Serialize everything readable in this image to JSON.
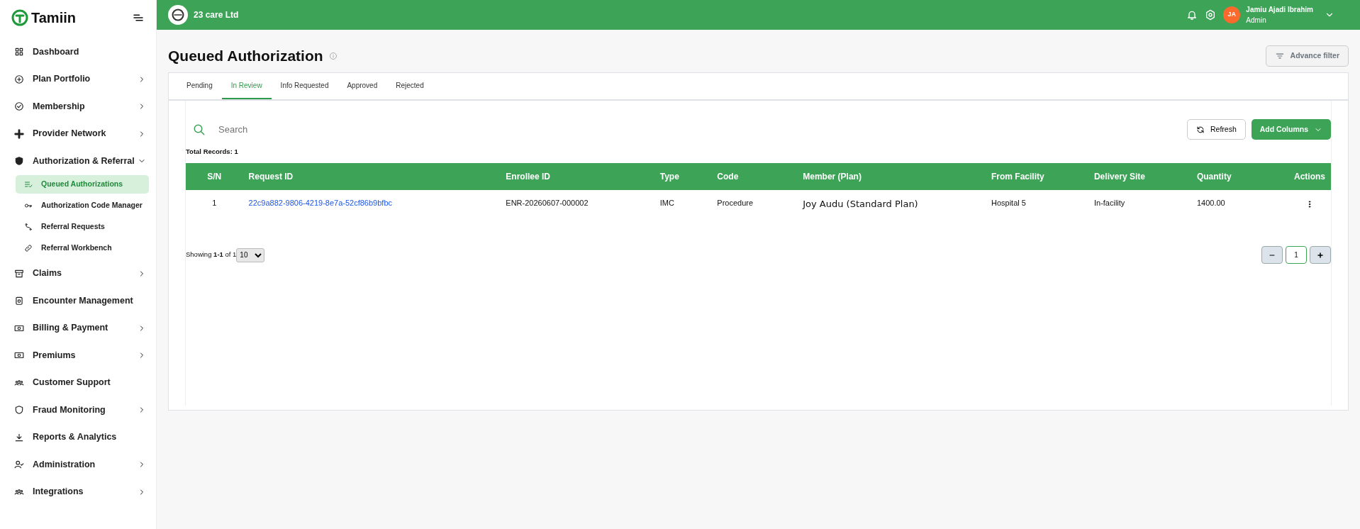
{
  "brand": {
    "name": "Tamiin"
  },
  "sidebar": {
    "items": [
      {
        "label": "Dashboard"
      },
      {
        "label": "Plan Portfolio",
        "expanded": false
      },
      {
        "label": "Membership",
        "expanded": false
      },
      {
        "label": "Provider Network",
        "expanded": false
      },
      {
        "label": "Authorization & Referral",
        "expanded": true,
        "children": [
          {
            "label": "Queued Authorizations",
            "selected": true
          },
          {
            "label": "Authorization Code Manager",
            "selected": false
          },
          {
            "label": "Referral Requests",
            "selected": false
          },
          {
            "label": "Referral Workbench",
            "selected": false
          }
        ]
      },
      {
        "label": "Claims",
        "expanded": false
      },
      {
        "label": "Encounter Management"
      },
      {
        "label": "Billing & Payment",
        "expanded": false
      },
      {
        "label": "Premiums",
        "expanded": false
      },
      {
        "label": "Customer Support"
      },
      {
        "label": "Fraud Monitoring",
        "expanded": false
      },
      {
        "label": "Reports & Analytics"
      },
      {
        "label": "Administration",
        "expanded": false
      },
      {
        "label": "Integrations",
        "expanded": false
      }
    ]
  },
  "topbar": {
    "org": "23 care Ltd",
    "user": {
      "initials": "JA",
      "name": "Jamiu Ajadi Ibrahim",
      "role": "Admin"
    }
  },
  "page": {
    "title": "Queued Authorization",
    "filter_button": "Advance filter"
  },
  "tabs": [
    {
      "label": "Pending",
      "selected": false
    },
    {
      "label": "In Review",
      "selected": true
    },
    {
      "label": "Info Requested",
      "selected": false
    },
    {
      "label": "Approved",
      "selected": false
    },
    {
      "label": "Rejected",
      "selected": false
    }
  ],
  "search": {
    "placeholder": "Search"
  },
  "buttons": {
    "refresh": "Refresh",
    "add_columns": "Add Columns"
  },
  "total_records": "Total Records: 1",
  "table": {
    "columns": [
      "S/N",
      "Request ID",
      "Enrollee ID",
      "Type",
      "Code",
      "Member (Plan)",
      "From Facility",
      "Delivery Site",
      "Quantity",
      "Actions"
    ],
    "rows": [
      {
        "sn": "1",
        "request_id": "22c9a882-9806-4219-8e7a-52cf86b9bfbc",
        "enrollee_id": "ENR-20260607-000002",
        "type": "IMC",
        "code": "Procedure",
        "member": "Joy Audu (Standard Plan)",
        "from_facility": "Hospital 5",
        "delivery_site": "In-facility",
        "quantity": "1400.00"
      }
    ]
  },
  "pagination": {
    "summary": "Showing **1-1** of 1",
    "page_size": "10",
    "page": "1"
  }
}
